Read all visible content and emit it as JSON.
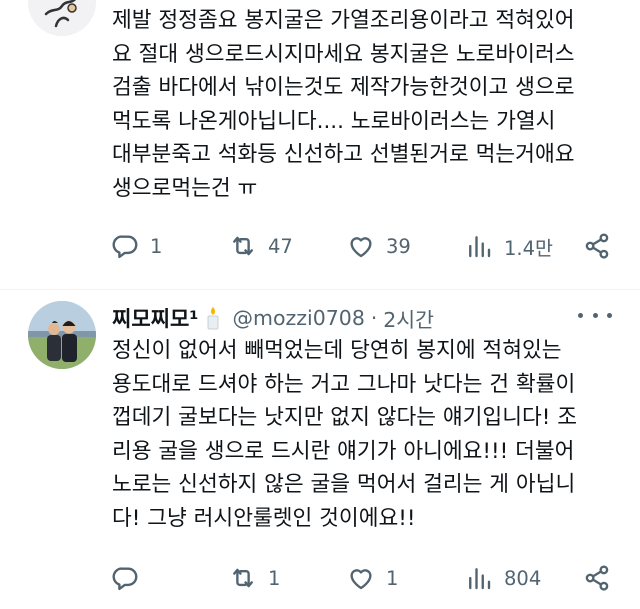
{
  "tweets": [
    {
      "body": "제발 정정좀요 봉지굴은 가열조리용이라고 적혀있어\n요 절대 생으로드시지마세요 봉지굴은 노로바이러스\n검출 바다에서 낚이는것도 제작가능한것이고 생으로\n먹도록 나온게아닙니다.... 노로바이러스는 가열시\n대부분죽고 석화등 신선하고 선별된거로 먹는거애요\n생으로먹는건 ㅠ",
      "replies": "1",
      "retweets": "47",
      "likes": "39",
      "views": "1.4만",
      "avatar_icon": "cartoon-figure-avatar"
    },
    {
      "display_name": "찌모찌모¹",
      "badge_icon": "candle-emoji-icon",
      "handle": "@mozzi0708",
      "separator": "·",
      "time": "2시간",
      "body": "정신이 없어서 빼먹었는데 당연히 봉지에 적혀있는\n용도대로 드셔야 하는 거고 그나마 낫다는 건 확률이\n껍데기 굴보다는 낫지만 없지 않다는 얘기입니다! 조\n리용 굴을 생으로 드시란 얘기가 아니에요!!! 더불어\n노로는 신선하지 않은 굴을 먹어서 걸리는 게 아닙니\n다! 그냥 러시안룰렛인 것이에요!!",
      "replies": "",
      "retweets": "1",
      "likes": "1",
      "views": "804",
      "avatar_icon": "couple-photo-avatar"
    }
  ],
  "colors": {
    "text": "#0f1419",
    "secondary": "#536471",
    "divider": "#eff3f4"
  }
}
